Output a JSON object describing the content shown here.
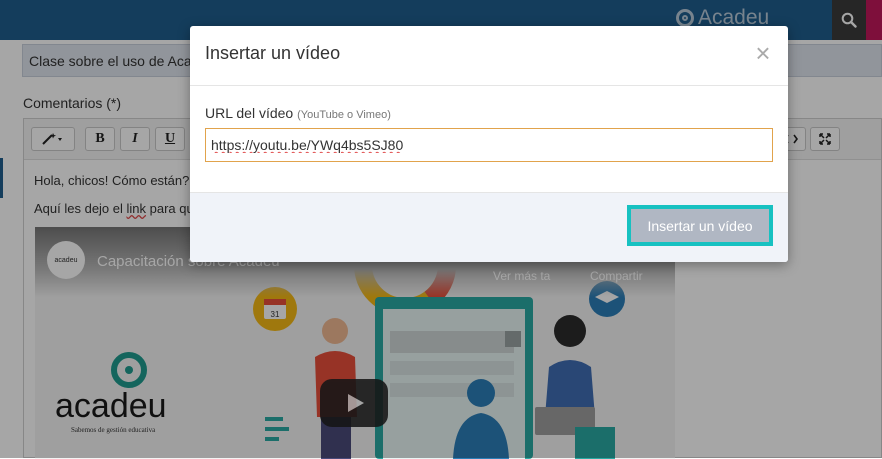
{
  "header": {
    "brand": "Acadeu"
  },
  "form": {
    "subject_value": "Clase sobre el uso de Acadeu",
    "comments_label": "Comentarios (*)"
  },
  "editor": {
    "toolbar": {
      "bold": "B",
      "italic": "I",
      "underline": "U"
    },
    "line1": "Hola, chicos! Cómo están?",
    "line2_start": "Aquí les dejo el ",
    "line2_link": "link",
    "line2_end": " para que"
  },
  "video": {
    "channel_avatar_text": "acadeu",
    "title": "Capacitación sobre Acadeu",
    "watch_later": "Ver más ta",
    "share": "Compartir",
    "logo_word": "acadeu",
    "logo_tagline": "Sabemos de gestión educativa",
    "calendar_number": "31"
  },
  "modal": {
    "title": "Insertar un vídeo",
    "close_symbol": "×",
    "url_label": "URL del vídeo",
    "url_hint": "(YouTube o Vimeo)",
    "url_value": "https://youtu.be/YWq4bs5SJ80",
    "insert_button": "Insertar un vídeo"
  }
}
